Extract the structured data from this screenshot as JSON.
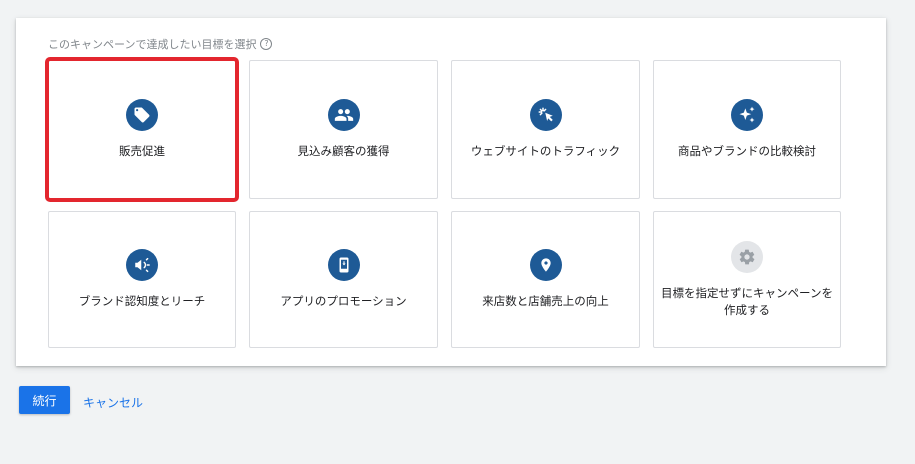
{
  "heading": {
    "text": "このキャンペーンで達成したい目標を選択",
    "help_icon": "?"
  },
  "goals": [
    {
      "label": "販売促進",
      "icon": "sales-tag-icon",
      "selected": true
    },
    {
      "label": "見込み顧客の獲得",
      "icon": "people-icon",
      "selected": false
    },
    {
      "label": "ウェブサイトのトラフィック",
      "icon": "cursor-click-icon",
      "selected": false
    },
    {
      "label": "商品やブランドの比較検討",
      "icon": "sparkle-icon",
      "selected": false
    },
    {
      "label": "ブランド認知度とリーチ",
      "icon": "megaphone-icon",
      "selected": false
    },
    {
      "label": "アプリのプロモーション",
      "icon": "phone-download-icon",
      "selected": false
    },
    {
      "label": "来店数と店舗売上の向上",
      "icon": "location-pin-icon",
      "selected": false
    },
    {
      "label": "目標を指定せずにキャンペーンを作成する",
      "icon": "gear-icon",
      "selected": false
    }
  ],
  "actions": {
    "continue_label": "続行",
    "cancel_label": "キャンセル"
  },
  "colors": {
    "icon_bg": "#1e5a96",
    "selected_outline": "#e3262e",
    "primary": "#1a73e8"
  }
}
